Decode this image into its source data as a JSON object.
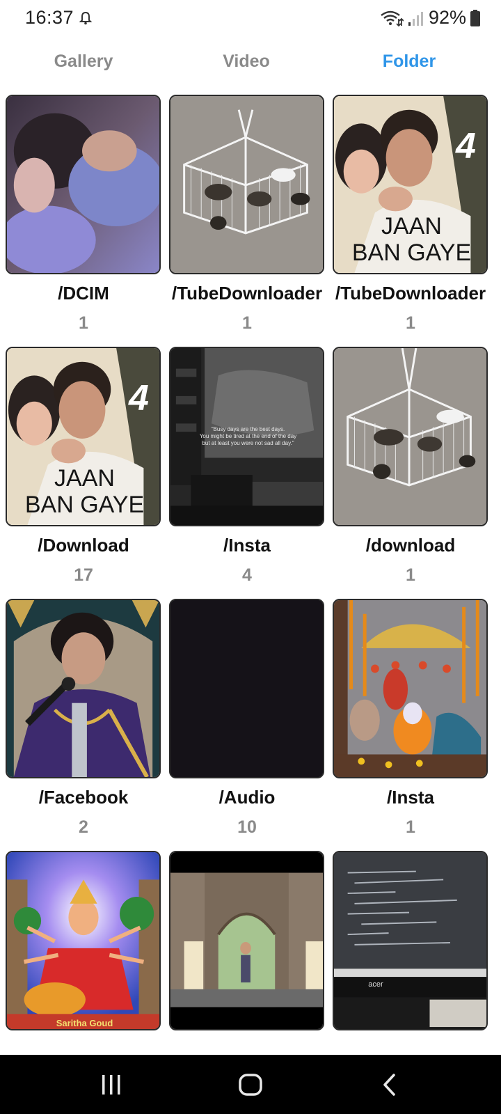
{
  "status": {
    "time": "16:37",
    "battery": "92%"
  },
  "tabs": [
    {
      "label": "Gallery",
      "active": false
    },
    {
      "label": "Video",
      "active": false
    },
    {
      "label": "Folder",
      "active": true
    }
  ],
  "colors": {
    "accent": "#2f95e8",
    "inactive_tab": "#8a8a8a",
    "count": "#8a8a8a"
  },
  "folders": [
    {
      "name": "/DCIM",
      "count": "1",
      "thumb": "blurry-video-frame"
    },
    {
      "name": "/TubeDownloader",
      "count": "1",
      "thumb": "bird-cage"
    },
    {
      "name": "/TubeDownloader",
      "count": "1",
      "thumb": "jaan-ban-gaye-poster",
      "poster_text": [
        "JAAN",
        "BAN GAYE"
      ],
      "poster_number": "4"
    },
    {
      "name": "/Download",
      "count": "17",
      "thumb": "jaan-ban-gaye-poster",
      "poster_text": [
        "JAAN",
        "BAN GAYE"
      ],
      "poster_number": "4"
    },
    {
      "name": "/Insta",
      "count": "4",
      "thumb": "dark-office-quote",
      "quote_lines": [
        "\"Busy days are the best days.",
        "You might be tired at the end of the day",
        "but at least you were not sad all day.\""
      ]
    },
    {
      "name": "/download",
      "count": "1",
      "thumb": "bird-cage"
    },
    {
      "name": "/Facebook",
      "count": "2",
      "thumb": "singer-on-stage"
    },
    {
      "name": "/Audio",
      "count": "10",
      "thumb": "blank-dark"
    },
    {
      "name": "/Insta",
      "count": "1",
      "thumb": "temple-decoration"
    },
    {
      "name": "",
      "count": "",
      "thumb": "goddess-painting",
      "caption": "Saritha Goud"
    },
    {
      "name": "",
      "count": "",
      "thumb": "stone-gateway"
    },
    {
      "name": "",
      "count": "",
      "thumb": "computer-screen",
      "monitor_brand": "acer"
    }
  ],
  "nav": {
    "recents": "recents-icon",
    "home": "home-icon",
    "back": "back-icon"
  }
}
